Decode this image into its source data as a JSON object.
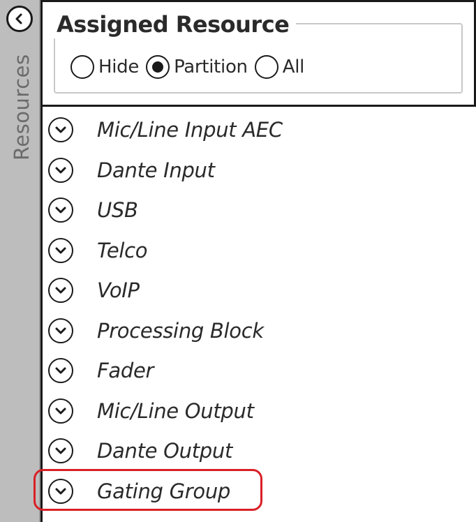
{
  "sidebar": {
    "title": "Resources",
    "collapse_icon": "chevron-left-icon"
  },
  "filter": {
    "title": "Assigned Resource",
    "options": [
      {
        "label": "Hide",
        "selected": false
      },
      {
        "label": "Partition",
        "selected": true
      },
      {
        "label": "All",
        "selected": false
      }
    ]
  },
  "resources": {
    "expand_icon": "chevron-down-circle-icon",
    "items": [
      {
        "label": "Mic/Line Input AEC"
      },
      {
        "label": "Dante Input"
      },
      {
        "label": "USB"
      },
      {
        "label": "Telco"
      },
      {
        "label": "VoIP"
      },
      {
        "label": "Processing Block"
      },
      {
        "label": "Fader"
      },
      {
        "label": "Mic/Line Output"
      },
      {
        "label": "Dante Output"
      },
      {
        "label": "Gating Group",
        "highlighted": true
      }
    ]
  },
  "colors": {
    "sidebar_bg": "#bdbdbd",
    "highlight": "#d91f26",
    "text": "#2a2a2a"
  }
}
